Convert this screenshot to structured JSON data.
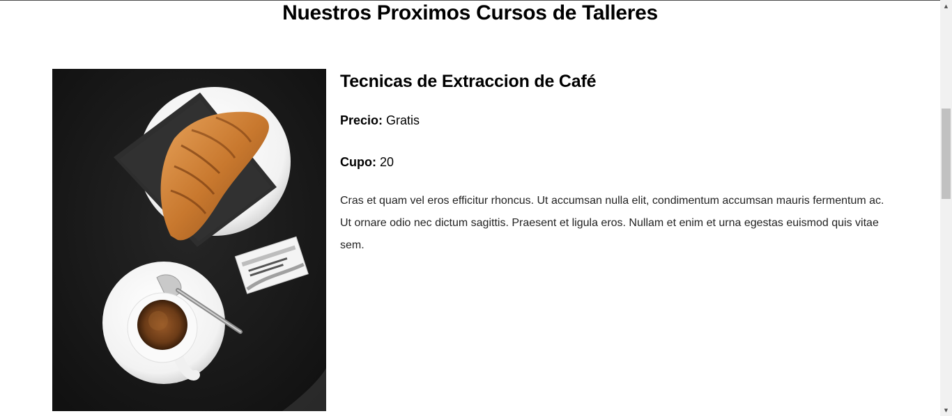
{
  "section": {
    "title": "Nuestros Proximos Cursos de Talleres"
  },
  "course": {
    "image_alt": "Croissant y café espresso sobre mesa negra",
    "title": "Tecnicas de Extraccion de Café",
    "price_label": "Precio:",
    "price_value": "Gratis",
    "quota_label": "Cupo:",
    "quota_value": "20",
    "description": "Cras et quam vel eros efficitur rhoncus. Ut accumsan nulla elit, condimentum accumsan mauris fermentum ac. Ut ornare odio nec dictum sagittis. Praesent et ligula eros. Nullam et enim et urna egestas euismod quis vitae sem."
  },
  "colors": {
    "table": "#1a1a1a",
    "napkin": "#2e2e2e",
    "croissant": "#c8782e",
    "coffee": "#6b3b17"
  },
  "scrollbar": {
    "up_icon": "scroll-up-arrow-icon",
    "down_icon": "scroll-down-arrow-icon"
  }
}
